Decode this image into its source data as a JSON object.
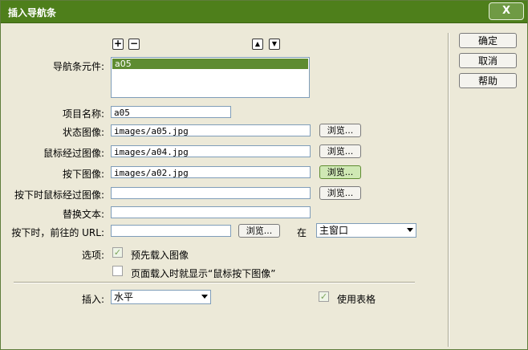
{
  "dialog": {
    "title": "插入导航条",
    "close_label": "X",
    "buttons": {
      "ok": "确定",
      "cancel": "取消",
      "help": "帮助"
    },
    "nav_elements": {
      "label": "导航条元件:",
      "add_label": "+",
      "remove_label": "−",
      "up_label": "▲",
      "down_label": "▼",
      "items": [
        "a05"
      ]
    },
    "item_name": {
      "label": "项目名称:",
      "value": "a05"
    },
    "state_image": {
      "label": "状态图像:",
      "value": "images/a05.jpg"
    },
    "rollover_image": {
      "label": "鼠标经过图像:",
      "value": "images/a04.jpg"
    },
    "down_image": {
      "label": "按下图像:",
      "value": "images/a02.jpg"
    },
    "over_while_down_image": {
      "label": "按下时鼠标经过图像:",
      "value": ""
    },
    "alt_text": {
      "label": "替换文本:",
      "value": ""
    },
    "when_clicked": {
      "label": "按下时，前往的 URL:",
      "value": "",
      "in_label": "在",
      "target": "主窗口"
    },
    "browse_label": "浏览...",
    "options": {
      "label": "选项:",
      "preload_label": "预先载入图像",
      "preload_checked": true,
      "show_down_label": "页面载入时就显示“鼠标按下图像”",
      "show_down_checked": false
    },
    "insert": {
      "label": "插入:",
      "value": "水平"
    },
    "use_tables": {
      "label": "使用表格",
      "checked": true
    }
  }
}
